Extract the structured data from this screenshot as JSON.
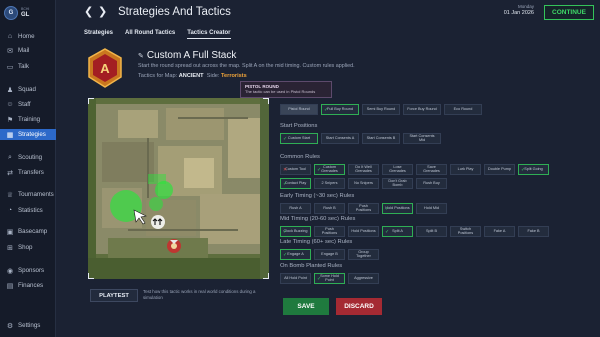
{
  "brand": {
    "small": "BCHI",
    "name": "GL"
  },
  "sidebar": {
    "items": [
      {
        "label": "Home",
        "icon": "home-icon",
        "active": false
      },
      {
        "label": "Mail",
        "icon": "mail-icon",
        "active": false
      },
      {
        "label": "Talk",
        "icon": "talk-icon",
        "active": false
      },
      {
        "label": "Squad",
        "icon": "squad-icon",
        "active": false
      },
      {
        "label": "Staff",
        "icon": "staff-icon",
        "active": false
      },
      {
        "label": "Training",
        "icon": "training-icon",
        "active": false
      },
      {
        "label": "Strategies",
        "icon": "strategies-icon",
        "active": true
      },
      {
        "label": "Scouting",
        "icon": "scouting-icon",
        "active": false
      },
      {
        "label": "Transfers",
        "icon": "transfers-icon",
        "active": false
      },
      {
        "label": "Tournaments",
        "icon": "tournaments-icon",
        "active": false
      },
      {
        "label": "Statistics",
        "icon": "statistics-icon",
        "active": false
      },
      {
        "label": "Basecamp",
        "icon": "basecamp-icon",
        "active": false
      },
      {
        "label": "Shop",
        "icon": "shop-icon",
        "active": false
      },
      {
        "label": "Sponsors",
        "icon": "sponsors-icon",
        "active": false
      },
      {
        "label": "Finances",
        "icon": "finances-icon",
        "active": false
      },
      {
        "label": "Settings",
        "icon": "settings-icon",
        "active": false
      }
    ]
  },
  "header": {
    "back": "❮",
    "forward": "❯",
    "title": "Strategies And Tactics",
    "date_day": "Monday",
    "date": "01 Jan 2026",
    "continue_label": "CONTINUE"
  },
  "tabs": [
    {
      "label": "Strategies",
      "active": false
    },
    {
      "label": "All Round Tactics",
      "active": false
    },
    {
      "label": "Tactics Creator",
      "active": true
    }
  ],
  "tactic": {
    "name": "Custom A Full Stack",
    "description": "Start the round spread out across the map. Split A on the mid timing. Custom rules applied.",
    "map_prefix": "Tactics for Map:",
    "map_name": "ANCIENT",
    "side_prefix": "Side:",
    "side": "Terrorists"
  },
  "tooltip": {
    "title": "PISTOL ROUND",
    "body": "The tactic can be used in Pistol Rounds"
  },
  "round_types": [
    {
      "label": "Pistol Round",
      "state": "hl"
    },
    {
      "label": "Full Buy Round",
      "state": "on"
    },
    {
      "label": "Semi Buy Round",
      "state": "none"
    },
    {
      "label": "Force Buy Round",
      "state": "none"
    },
    {
      "label": "Eco Round",
      "state": "none"
    }
  ],
  "sections": {
    "start_positions": "Start Positions",
    "common_rules": "Common Rules",
    "early": "Early Timing (~30 sec) Rules",
    "mid": "Mid Timing (20-60 sec) Rules",
    "late": "Late Timing (60+ sec) Rules",
    "bomb": "On Bomb Planted Rules"
  },
  "start_positions": [
    {
      "label": "Custom Start",
      "state": "on"
    },
    {
      "label": "Start Consents A",
      "state": "none"
    },
    {
      "label": "Start Consents B",
      "state": "none"
    },
    {
      "label": "Start Consents Mid",
      "state": "none"
    }
  ],
  "common_rules_row1": [
    {
      "label": "Custom Tool",
      "state": "off"
    },
    {
      "label": "Custom Grenades",
      "state": "on"
    },
    {
      "label": "Do It Well Grenades",
      "state": "none"
    },
    {
      "label": "Lose Grenades",
      "state": "none"
    },
    {
      "label": "Save Grenades",
      "state": "none"
    },
    {
      "label": "Lurk Play",
      "state": "none"
    },
    {
      "label": "Double Pump",
      "state": "none"
    },
    {
      "label": "Split Going",
      "state": "on"
    }
  ],
  "common_rules_row2": [
    {
      "label": "Contact Play",
      "state": "on"
    },
    {
      "label": "2 Snipers",
      "state": "none"
    },
    {
      "label": "No Snipers",
      "state": "none"
    },
    {
      "label": "Don't Grab Bomb",
      "state": "none"
    },
    {
      "label": "Rush Buy",
      "state": "none"
    }
  ],
  "early_rules": [
    {
      "label": "Rush A",
      "state": "none"
    },
    {
      "label": "Rush B",
      "state": "none"
    },
    {
      "label": "Push Positions",
      "state": "none"
    },
    {
      "label": "Hold Positions",
      "state": "on"
    },
    {
      "label": "Hold Mid",
      "state": "none"
    }
  ],
  "mid_rules": [
    {
      "label": "Clock Buzzing",
      "state": "on"
    },
    {
      "label": "Push Positions",
      "state": "none"
    },
    {
      "label": "Hold Positions",
      "state": "none"
    },
    {
      "label": "Split A",
      "state": "on"
    },
    {
      "label": "Split B",
      "state": "none"
    },
    {
      "label": "Switch Positions",
      "state": "none"
    },
    {
      "label": "Fake A",
      "state": "none"
    },
    {
      "label": "Fake B",
      "state": "none"
    }
  ],
  "late_rules": [
    {
      "label": "Engage A",
      "state": "on"
    },
    {
      "label": "Engage B",
      "state": "none"
    },
    {
      "label": "Group Together",
      "state": "none"
    }
  ],
  "bomb_rules": [
    {
      "label": "All Hold Point",
      "state": "none"
    },
    {
      "label": "Some Hold Point",
      "state": "on"
    },
    {
      "label": "Aggressive",
      "state": "none"
    }
  ],
  "playtest": {
    "label": "PLAYTEST",
    "description": "Test how this tactic works in real world conditions during a simulation"
  },
  "footer": {
    "save_label": "SAVE",
    "discard_label": "DISCARD"
  },
  "colors": {
    "accent": "#2c69c9",
    "continue": "#34c35a",
    "save": "#1f7a3e",
    "discard": "#a52a33",
    "side": "#f0a43a"
  }
}
